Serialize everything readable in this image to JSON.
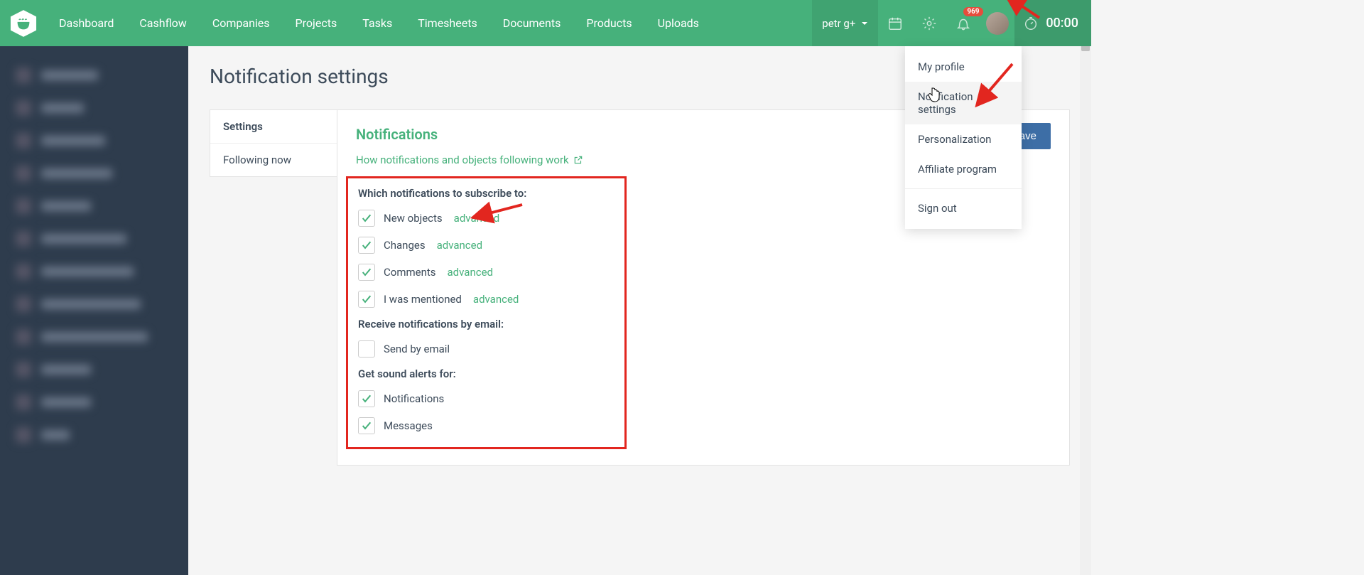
{
  "nav": {
    "links": [
      "Dashboard",
      "Cashflow",
      "Companies",
      "Projects",
      "Tasks",
      "Timesheets",
      "Documents",
      "Products",
      "Uploads"
    ],
    "user": "petr g+",
    "badge": "969",
    "timer": "00:00"
  },
  "menu": {
    "items": [
      "My profile",
      "Notification settings",
      "Personalization",
      "Affiliate program"
    ],
    "signout": "Sign out"
  },
  "page": {
    "title": "Notification settings",
    "tabs": {
      "settings": "Settings",
      "following": "Following now"
    },
    "section_heading": "Notifications",
    "help_link": "How notifications and objects following work",
    "save": "Save",
    "group_subscribe": "Which notifications to subscribe to:",
    "group_email": "Receive notifications by email:",
    "group_sound": "Get sound alerts for:",
    "advanced": "advanced",
    "checks": {
      "new_objects": "New objects",
      "changes": "Changes",
      "comments": "Comments",
      "mentioned": "I was mentioned",
      "send_email": "Send by email",
      "notifications": "Notifications",
      "messages": "Messages"
    }
  }
}
